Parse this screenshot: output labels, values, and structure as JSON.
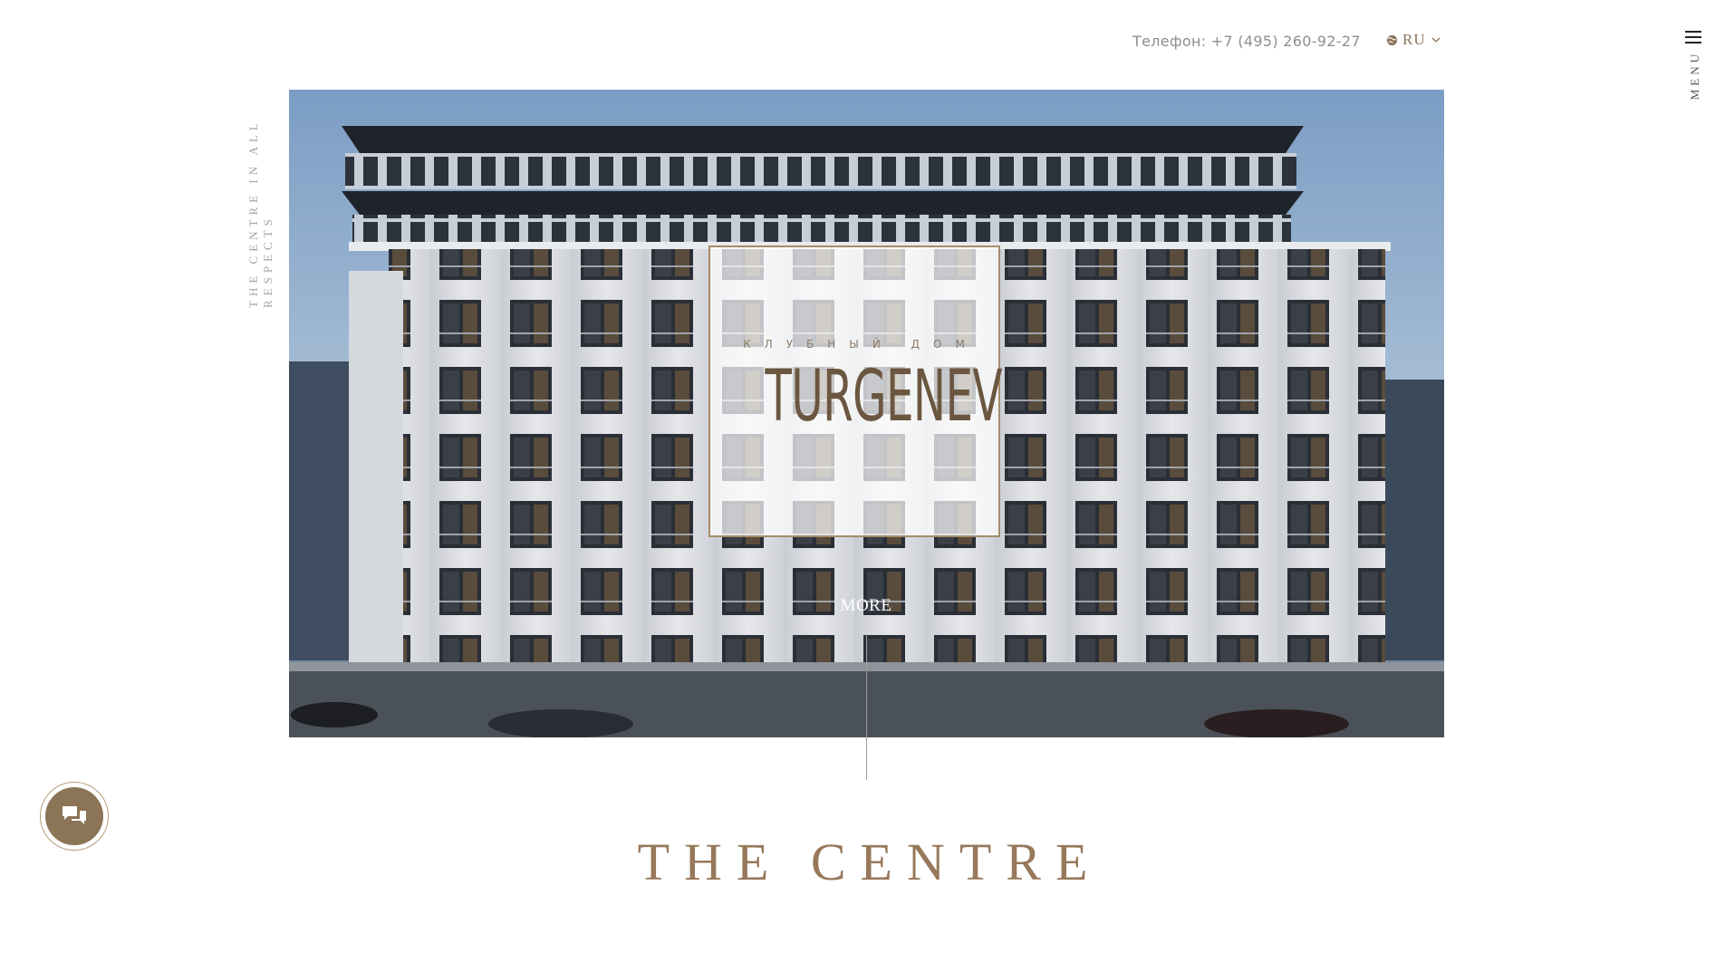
{
  "tagline": "THE CENTRE IN ALL RESPECTS",
  "header": {
    "phone": "Телефон: +7 (495) 260-92-27",
    "language": "RU"
  },
  "menu": {
    "label": "MENU"
  },
  "hero": {
    "brand_subtitle": "КЛУБНЫЙ ДОМ",
    "brand_name": "TURGENEV",
    "more_label": "MORE"
  },
  "section": {
    "title": "THE CENTRE"
  },
  "colors": {
    "accent": "#8c7457",
    "brand_text": "#6b5640"
  },
  "icons": {
    "language": "globe-icon",
    "dropdown": "chevron-down-icon",
    "menu": "hamburger-icon",
    "chat": "chat-bubbles-icon"
  }
}
